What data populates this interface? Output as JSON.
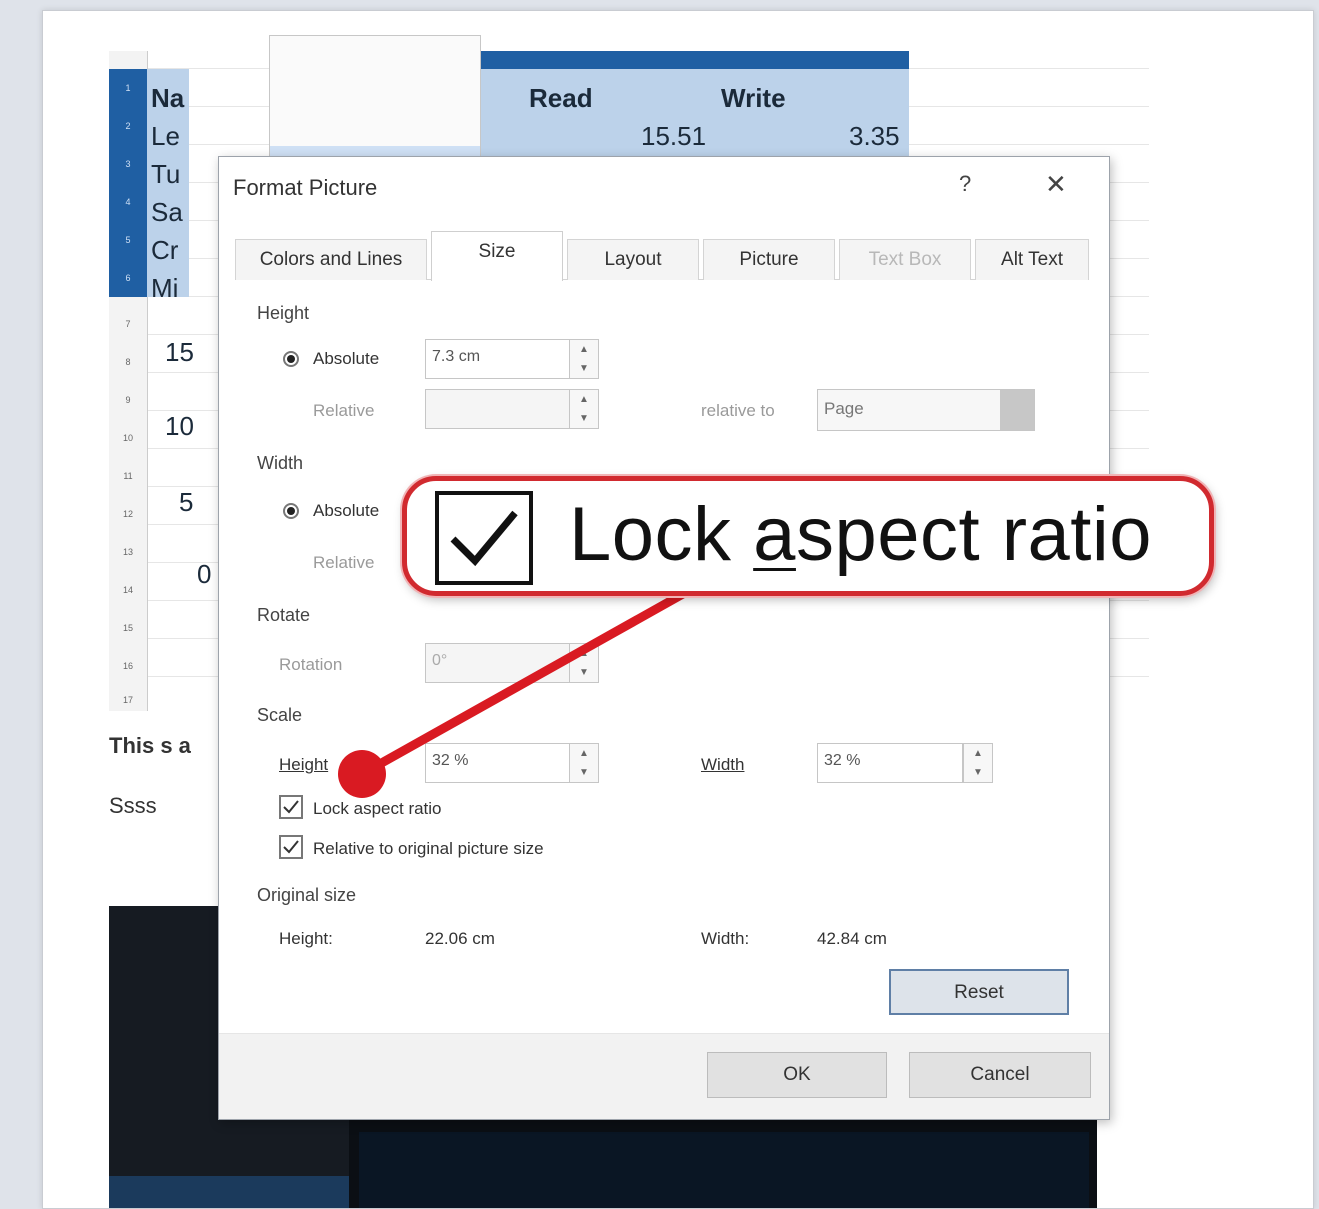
{
  "spreadsheet": {
    "name_col_fragments": [
      "Na",
      "Le",
      "Tu",
      "Sa",
      "Cr",
      "Mi"
    ],
    "headers": [
      "Read",
      "Write"
    ],
    "values": [
      "15.51",
      "3.35"
    ],
    "partial_numbers": [
      "15",
      "10",
      "5",
      "0"
    ],
    "row_numbers_selected": [
      "1",
      "2",
      "3",
      "4",
      "5",
      "6"
    ],
    "row_numbers": [
      "7",
      "8",
      "9",
      "10",
      "11",
      "12",
      "13",
      "14",
      "15",
      "16",
      "17"
    ]
  },
  "doc": {
    "text_line_1": "This s a",
    "text_line_2": "Ssss"
  },
  "dialog": {
    "title": "Format Picture",
    "help_icon": "help-icon",
    "close_icon": "close-icon",
    "tabs": [
      {
        "label": "Colors and Lines",
        "active": false,
        "disabled": false
      },
      {
        "label": "Size",
        "active": true,
        "disabled": false
      },
      {
        "label": "Layout",
        "active": false,
        "disabled": false
      },
      {
        "label": "Picture",
        "active": false,
        "disabled": false
      },
      {
        "label": "Text Box",
        "active": false,
        "disabled": true
      },
      {
        "label": "Alt Text",
        "active": false,
        "disabled": false
      }
    ],
    "height_section": "Height",
    "absolute_label": "Absolute",
    "height_absolute_value": "7.3 cm",
    "relative_label": "Relative",
    "relative_to_label": "relative to",
    "relative_to_value": "Page",
    "width_section": "Width",
    "rotate_section": "Rotate",
    "rotation_label": "Rotation",
    "rotation_value": "0°",
    "scale_section": "Scale",
    "scale_height_label": "Height",
    "scale_height_value": "32 %",
    "scale_width_label": "Width",
    "scale_width_value": "32 %",
    "lock_aspect_label": "Lock aspect ratio",
    "lock_aspect_checked": true,
    "relative_original_label": "Relative to original picture size",
    "relative_original_checked": true,
    "original_size_section": "Original size",
    "orig_height_label": "Height:",
    "orig_height_value": "22.06 cm",
    "orig_width_label": "Width:",
    "orig_width_value": "42.84 cm",
    "reset_label": "Reset",
    "ok_label": "OK",
    "cancel_label": "Cancel"
  },
  "callout": {
    "text_before": "Lock ",
    "text_underlined": "a",
    "text_after": "spect ratio",
    "checked": true,
    "accent_color": "#d12a2f"
  }
}
